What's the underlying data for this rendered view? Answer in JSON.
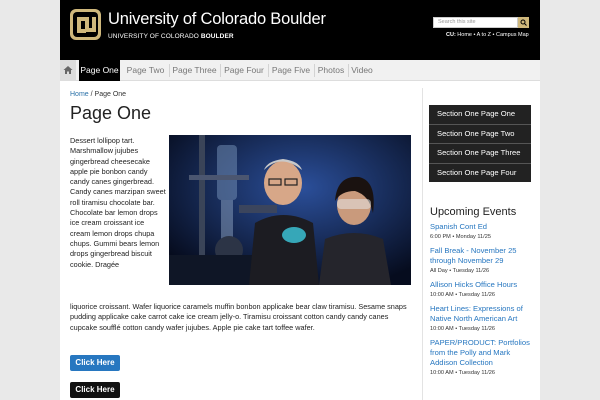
{
  "header": {
    "title": "University of Colorado Boulder",
    "subtitle_main": "UNIVERSITY OF COLORADO ",
    "subtitle_bold": "BOULDER",
    "search_placeholder": "Search this site",
    "top_links_prefix": "CU:",
    "top_links": " Home • A to Z • Campus Map"
  },
  "nav": {
    "items": [
      {
        "label": "Page One"
      },
      {
        "label": "Page Two"
      },
      {
        "label": "Page Three"
      },
      {
        "label": "Page Four"
      },
      {
        "label": "Page Five"
      },
      {
        "label": "Photos"
      },
      {
        "label": "Video"
      }
    ]
  },
  "breadcrumb": {
    "home": "Home",
    "sep": " / ",
    "current": "Page One"
  },
  "main": {
    "title": "Page One",
    "para_narrow": "Dessert lollipop tart. Marshmallow jujubes gingerbread cheesecake apple pie bonbon candy candy canes gingerbread. Candy canes marzipan sweet roll tiramisu chocolate bar. Chocolate bar lemon drops ice cream croissant ice cream lemon drops chupa chups. Gummi bears lemon drops gingerbread biscuit cookie. Dragée",
    "para_wide": "liquorice croissant. Wafer liquorice caramels muffin bonbon applicake bear claw tiramisu. Sesame snaps pudding applicake cake carrot cake ice cream jelly-o. Tiramisu croissant cotton candy candy canes cupcake soufflé cotton candy wafer jujubes. Apple pie cake tart toffee wafer.",
    "button_blue": "Click Here",
    "button_black": "Click Here"
  },
  "sidebar": {
    "menu": [
      {
        "label": "Section One Page One"
      },
      {
        "label": "Section One Page Two"
      },
      {
        "label": "Section One Page Three"
      },
      {
        "label": "Section One Page Four"
      }
    ],
    "events_title": "Upcoming Events",
    "events": [
      {
        "title": "Spanish Cont Ed",
        "meta": "6:00 PM • Monday 11/25"
      },
      {
        "title": "Fall Break - November 25 through November 29",
        "meta": "All Day • Tuesday 11/26"
      },
      {
        "title": "Allison Hicks Office Hours",
        "meta": "10:00 AM • Tuesday 11/26"
      },
      {
        "title": "Heart Lines: Expressions of Native North American Art",
        "meta": "10:00 AM • Tuesday 11/26"
      },
      {
        "title": "PAPER/PRODUCT: Portfolios from the Polly and Mark Addison Collection",
        "meta": "10:00 AM • Tuesday 11/26"
      }
    ]
  },
  "colors": {
    "accent_gold": "#cfb87c",
    "link_blue": "#2777c0",
    "header_black": "#000000"
  },
  "icons": {
    "logo": "cu-logo-icon",
    "search": "search-icon",
    "home": "home-icon"
  }
}
